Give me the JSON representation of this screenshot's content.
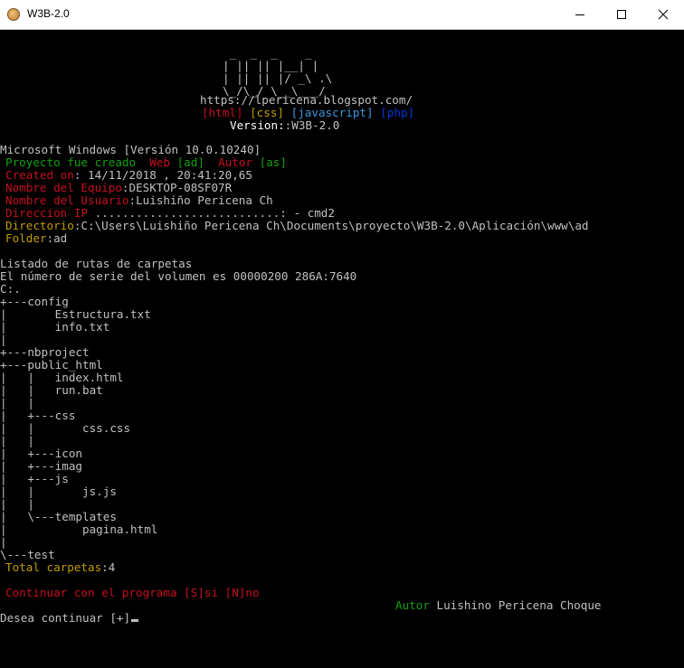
{
  "window": {
    "title": "W3B-2.0",
    "icon": "app-icon",
    "controls": [
      "minimize-icon",
      "maximize-icon",
      "close-icon"
    ]
  },
  "banner": {
    "logo": [
      " _  _  _    _ ",
      "| || || |__| |",
      "| || || |/ _\\ .\\",
      "\\_/\\_/ \\__\\___/",
      "           "
    ],
    "url": "https://lpericena.blogspot.com/",
    "tag_html": "[html]",
    "tag_css": "[css]",
    "tag_js": "[javascript]",
    "tag_php": "[php]",
    "version_label": "Version:",
    "version_value": ":W3B-2.0"
  },
  "system": {
    "os_line": "Microsoft Windows [Versión 10.0.10240]",
    "project_label": "Proyecto fue creado",
    "web_label": "Web",
    "web_value": "[ad]",
    "author_label": "Autor",
    "author_value": "[as]",
    "created_label": "Created on",
    "created_value": ": 14/11/2018 , 20:41:20,65",
    "team_label": "Nombre del Equipo",
    "team_value": ":DESKTOP-08SF07R",
    "user_label": "Nombre del Usuario",
    "user_value": ":Luishiño Pericena Ch",
    "ip_label": "Direccion IP",
    "ip_value": " ...........................: - cmd2",
    "dir_label": "Directorio",
    "dir_value": ":C:\\Users\\Luishiño Pericena Ch\\Documents\\proyecto\\W3B-2.0\\Aplicación\\www\\ad",
    "folder_label": "Folder",
    "folder_value": ":ad"
  },
  "listing": {
    "title": "Listado de rutas de carpetas",
    "serial": "El número de serie del volumen es 00000200 286A:7640",
    "root": "C:.",
    "tree": [
      "+---config",
      "|       Estructura.txt",
      "|       info.txt",
      "|",
      "+---nbproject",
      "+---public_html",
      "|   |   index.html",
      "|   |   run.bat",
      "|   |",
      "|   +---css",
      "|   |       css.css",
      "|   |",
      "|   +---icon",
      "|   +---imag",
      "|   +---js",
      "|   |       js.js",
      "|   |",
      "|   \\---templates",
      "|           pagina.html",
      "|",
      "\\---test"
    ],
    "total_label": "Total carpetas",
    "total_value": ":4"
  },
  "prompt": {
    "continue_line": "Continuar con el programa [S]si [N]no",
    "author_label": "Autor",
    "author_name": "Luishino Pericena Choque",
    "input_prompt": "Desea continuar [+]"
  },
  "colors": {
    "background": "#000000",
    "text": "#c0c0c0",
    "green": "#13a10e",
    "red": "#c50f1f",
    "olive": "#c19c00",
    "cyan": "#3a96dd",
    "blue": "#0037da"
  }
}
